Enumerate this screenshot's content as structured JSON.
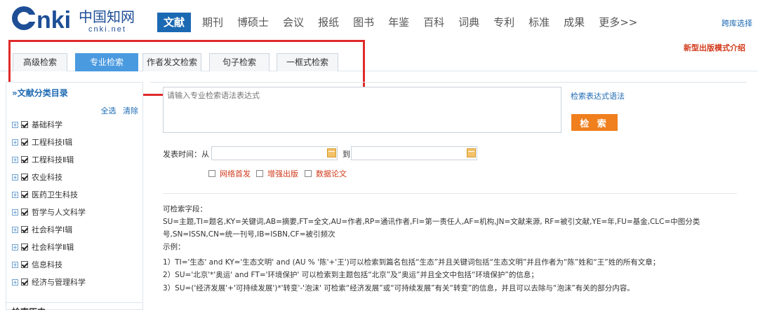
{
  "header": {
    "logo_text": "cnki.net",
    "nav": [
      {
        "label": "文献",
        "active": true
      },
      {
        "label": "期刊"
      },
      {
        "label": "博硕士"
      },
      {
        "label": "会议"
      },
      {
        "label": "报纸"
      },
      {
        "label": "图书"
      },
      {
        "label": "年鉴"
      },
      {
        "label": "百科"
      },
      {
        "label": "词典"
      },
      {
        "label": "专利"
      },
      {
        "label": "标准"
      },
      {
        "label": "成果"
      },
      {
        "label": "更多>>"
      }
    ],
    "cross_db": "跨库选择"
  },
  "tabs": {
    "items": [
      "高级检索",
      "专业检索",
      "作者发文检索",
      "句子检索",
      "一框式检索"
    ],
    "active_index": 1,
    "new_mode": "新型出版模式介绍"
  },
  "sidebar": {
    "title": "»文献分类目录",
    "select_all": "全选",
    "clear": "清除",
    "categories": [
      "基础科学",
      "工程科技Ⅰ辑",
      "工程科技Ⅱ辑",
      "农业科技",
      "医药卫生科技",
      "哲学与人文科学",
      "社会科学Ⅰ辑",
      "社会科学Ⅱ辑",
      "信息科技",
      "经济与管理科学"
    ],
    "next_title": "检索历史"
  },
  "search": {
    "placeholder": "请输入专业检索语法表达式",
    "syntax_link": "检索表达式语法",
    "button": "检 索",
    "date_from_label": "发表时间：从",
    "date_to_label": "到",
    "options": [
      "网络首发",
      "增强出版",
      "数据论文"
    ]
  },
  "help": {
    "fields_title": "可检索字段：",
    "fields_line1": "SU=主题,TI=题名,KY=关键词,AB=摘要,FT=全文,AU=作者,RP=通讯作者,FI=第一责任人,AF=机构,JN=文献来源, RF=被引文献,YE=年,FU=基金,CLC=中图分类",
    "fields_line2": "号,SN=ISSN,CN=统一刊号,IB=ISBN,CF=被引频次",
    "examples_title": "示例：",
    "example1": "1）TI='生态' and KY='生态文明' and (AU % '陈'+'王')可以检索到篇名包括“生态”并且关键词包括“生态文明”并且作者为“陈”姓和“王”姓的所有文章；",
    "example2": "2）SU='北京'*'奥运' and FT='环境保护' 可以检索到主题包括“北京”及“奥运”并且全文中包括“环境保护”的信息；",
    "example3": "3）SU=('经济发展'+'可持续发展')*'转变'-'泡沫' 可检索“经济发展”或“可持续发展”有关“转变”的信息，并且可以去除与“泡沫”有关的部分内容。"
  }
}
